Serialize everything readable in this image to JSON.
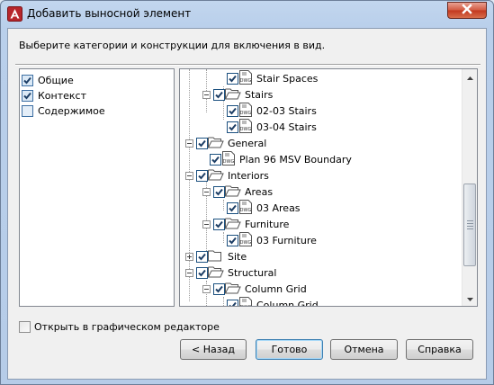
{
  "window": {
    "title": "Добавить выносной элемент",
    "close_icon": "close-icon",
    "app_icon": "autocad-logo-icon",
    "accent": "#c2371e"
  },
  "instruction": "Выберите категории и конструкции для включения в вид.",
  "categories": [
    {
      "label": "Общие",
      "checked": true
    },
    {
      "label": "Контекст",
      "checked": true
    },
    {
      "label": "Содержимое",
      "checked": false
    }
  ],
  "tree": {
    "nodes": [
      {
        "label": "Stair Spaces",
        "type": "file",
        "checked": true
      },
      {
        "label": "Stairs",
        "type": "folder",
        "checked": true,
        "expanded": true
      },
      {
        "label": "02-03 Stairs",
        "type": "file",
        "checked": true
      },
      {
        "label": "03-04 Stairs",
        "type": "file",
        "checked": true
      },
      {
        "label": "General",
        "type": "folder",
        "checked": true,
        "expanded": true
      },
      {
        "label": "Plan 96 MSV Boundary",
        "type": "file",
        "checked": true
      },
      {
        "label": "Interiors",
        "type": "folder",
        "checked": true,
        "expanded": true
      },
      {
        "label": "Areas",
        "type": "folder",
        "checked": true,
        "expanded": true
      },
      {
        "label": "03 Areas",
        "type": "file",
        "checked": true
      },
      {
        "label": "Furniture",
        "type": "folder",
        "checked": true,
        "expanded": true
      },
      {
        "label": "03 Furniture",
        "type": "file",
        "checked": true
      },
      {
        "label": "Site",
        "type": "folder",
        "checked": true,
        "expanded": false
      },
      {
        "label": "Structural",
        "type": "folder",
        "checked": true,
        "expanded": true
      },
      {
        "label": "Column Grid",
        "type": "folder",
        "checked": true,
        "expanded": true
      },
      {
        "label": "Column Grid",
        "type": "file",
        "checked": true
      }
    ],
    "file_icon_text": "DWG"
  },
  "open_in_editor": {
    "label": "Открыть в графическом редакторе",
    "checked": false
  },
  "buttons": {
    "back": "< Назад",
    "done": "Готово",
    "cancel": "Отмена",
    "help": "Справка"
  }
}
